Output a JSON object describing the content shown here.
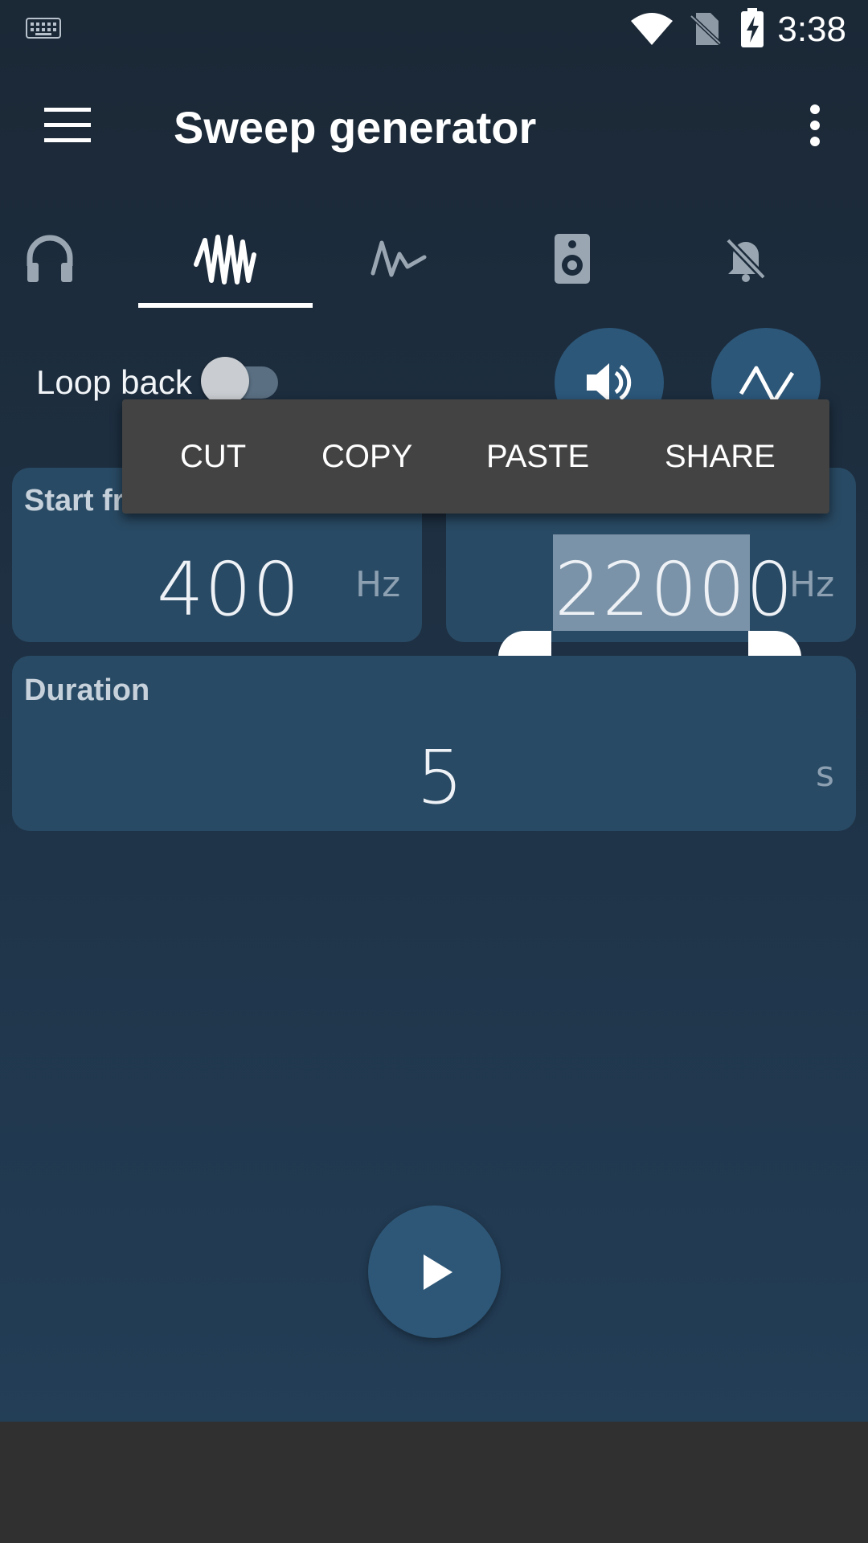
{
  "status_bar": {
    "time": "3:38",
    "icons": [
      "keyboard-icon",
      "wifi-icon",
      "no-sim-icon",
      "battery-charging-icon"
    ]
  },
  "app_bar": {
    "title": "Sweep generator",
    "icons": [
      "menu-icon",
      "more-vert-icon"
    ]
  },
  "tabs": [
    {
      "icon": "headphones-icon",
      "selected": false
    },
    {
      "icon": "sweep-wave-icon",
      "selected": true
    },
    {
      "icon": "pulse-wave-icon",
      "selected": false
    },
    {
      "icon": "speaker-icon",
      "selected": false
    },
    {
      "icon": "muted-bell-icon",
      "selected": false
    }
  ],
  "loop_back": {
    "label": "Loop back",
    "enabled": false
  },
  "context_menu": {
    "items": [
      "CUT",
      "COPY",
      "PASTE",
      "SHARE"
    ]
  },
  "start_frequency": {
    "label": "Start fr",
    "value": "400",
    "unit": "Hz"
  },
  "end_frequency": {
    "value": "22000",
    "unit": "Hz",
    "selected": true
  },
  "duration": {
    "label": "Duration",
    "value": "5",
    "unit": "s"
  },
  "colors": {
    "background": "#1e3144",
    "card": "#294a64",
    "accent": "#2c5779",
    "menu": "#434343",
    "selection": "#7b93a8"
  }
}
